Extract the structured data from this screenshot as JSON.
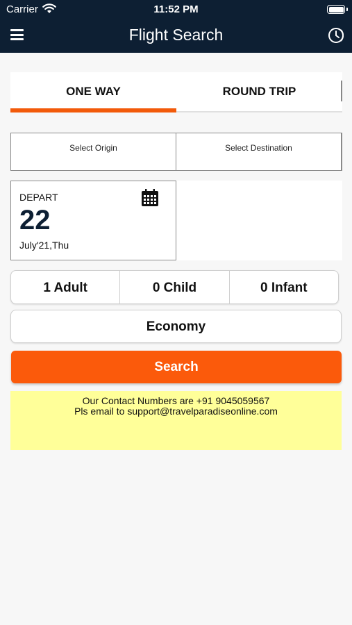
{
  "status_bar": {
    "carrier": "Carrier",
    "time": "11:52 PM"
  },
  "nav": {
    "title": "Flight Search",
    "menu_icon": "hamburger-menu-icon",
    "history_icon": "history-clock-icon"
  },
  "trip_tabs": [
    {
      "label": "ONE WAY",
      "active": true
    },
    {
      "label": "ROUND TRIP",
      "active": false
    }
  ],
  "route": {
    "origin_placeholder": "Select Origin",
    "destination_placeholder": "Select Destination"
  },
  "depart": {
    "label": "DEPART",
    "day": "22",
    "month_weekday": "July'21,Thu",
    "icon": "calendar-icon"
  },
  "passengers": [
    {
      "label": "1 Adult"
    },
    {
      "label": "0 Child"
    },
    {
      "label": "0 Infant"
    }
  ],
  "cabin_class": "Economy",
  "search_label": "Search",
  "contact": {
    "line1": "Our Contact Numbers are +91 9045059567",
    "line2": "Pls email to support@travelparadiseonline.com"
  },
  "colors": {
    "nav_bg": "#0d1f33",
    "accent": "#fb5a0b",
    "contact_bg": "#ffff99"
  }
}
